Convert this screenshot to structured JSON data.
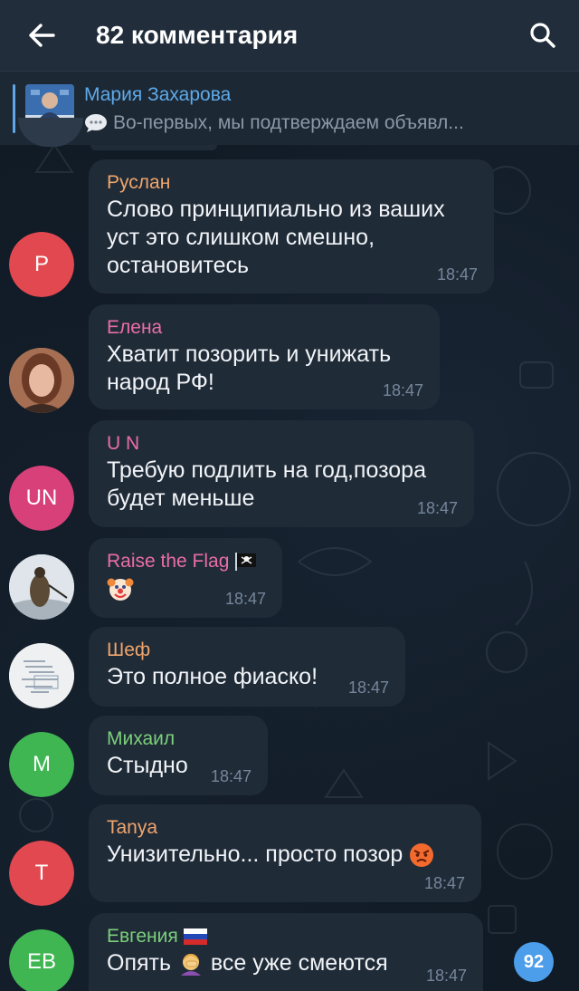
{
  "header": {
    "title": "82 комментария",
    "back_icon": "arrow-left-icon",
    "search_icon": "search-icon"
  },
  "pinned": {
    "name": "Мария Захарова",
    "text": "Во-первых, мы подтверждаем объявл..."
  },
  "messages": [
    {
      "name": "Руслан",
      "name_color": "#f0a56b",
      "text": "Слово принципиально из ваших уст это слишком смешно, остановитесь",
      "time": "18:47",
      "avatar": "Р",
      "avatar_color": "#e2484f"
    },
    {
      "name": "Елена",
      "name_color": "#ea6ea6",
      "text": "Хватит позорить и унижать народ РФ!",
      "time": "18:47",
      "avatar": "",
      "avatar_color": "#b47a5c"
    },
    {
      "name": "U N",
      "name_color": "#ea6ea6",
      "text": "Требую подлить на год,позора будет меньше",
      "time": "18:47",
      "avatar": "UN",
      "avatar_color": "#d8407a"
    },
    {
      "name": "Raise the Flag",
      "name_color": "#ea6ea6",
      "text": "",
      "time": "18:47",
      "avatar": "",
      "avatar_color": "#d6dde4"
    },
    {
      "name": "Шеф",
      "name_color": "#f0a56b",
      "text": "Это полное фиаско!",
      "time": "18:47",
      "avatar": "",
      "avatar_color": "#e8eaeb"
    },
    {
      "name": "Михаил",
      "name_color": "#7bd07a",
      "text": "Стыдно",
      "time": "18:47",
      "avatar": "М",
      "avatar_color": "#3fb652"
    },
    {
      "name": "Tanya",
      "name_color": "#f0a56b",
      "text": "Унизительно... просто позор",
      "time": "18:47",
      "avatar": "Т",
      "avatar_color": "#e2484f"
    },
    {
      "name": "Евгения",
      "name_color": "#7bd07a",
      "text_before": "Опять",
      "text_after": "все уже смеются",
      "time": "18:47",
      "avatar": "ЕВ",
      "avatar_color": "#3fb652"
    }
  ],
  "scroll_badge": "92"
}
